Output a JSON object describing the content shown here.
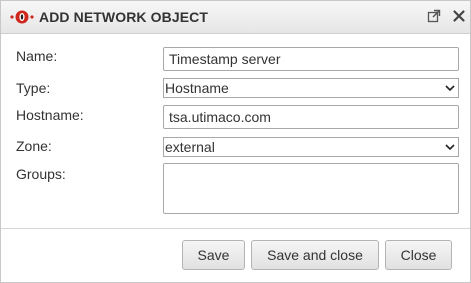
{
  "dialog": {
    "title": "ADD NETWORK OBJECT",
    "logo_icon": "utm-logo-icon",
    "popout_icon": "external-link-icon",
    "close_icon": "close-icon"
  },
  "form": {
    "name": {
      "label": "Name:",
      "value": "Timestamp server"
    },
    "type": {
      "label": "Type:",
      "value": "Hostname",
      "options": [
        "Hostname"
      ]
    },
    "hostname": {
      "label": "Hostname:",
      "value": "tsa.utimaco.com"
    },
    "zone": {
      "label": "Zone:",
      "value": "external",
      "options": [
        "external"
      ]
    },
    "groups": {
      "label": "Groups:",
      "value": ""
    }
  },
  "buttons": {
    "save": "Save",
    "save_and_close": "Save and close",
    "close": "Close"
  },
  "colors": {
    "logo_red": "#d0271d",
    "text": "#333333"
  }
}
